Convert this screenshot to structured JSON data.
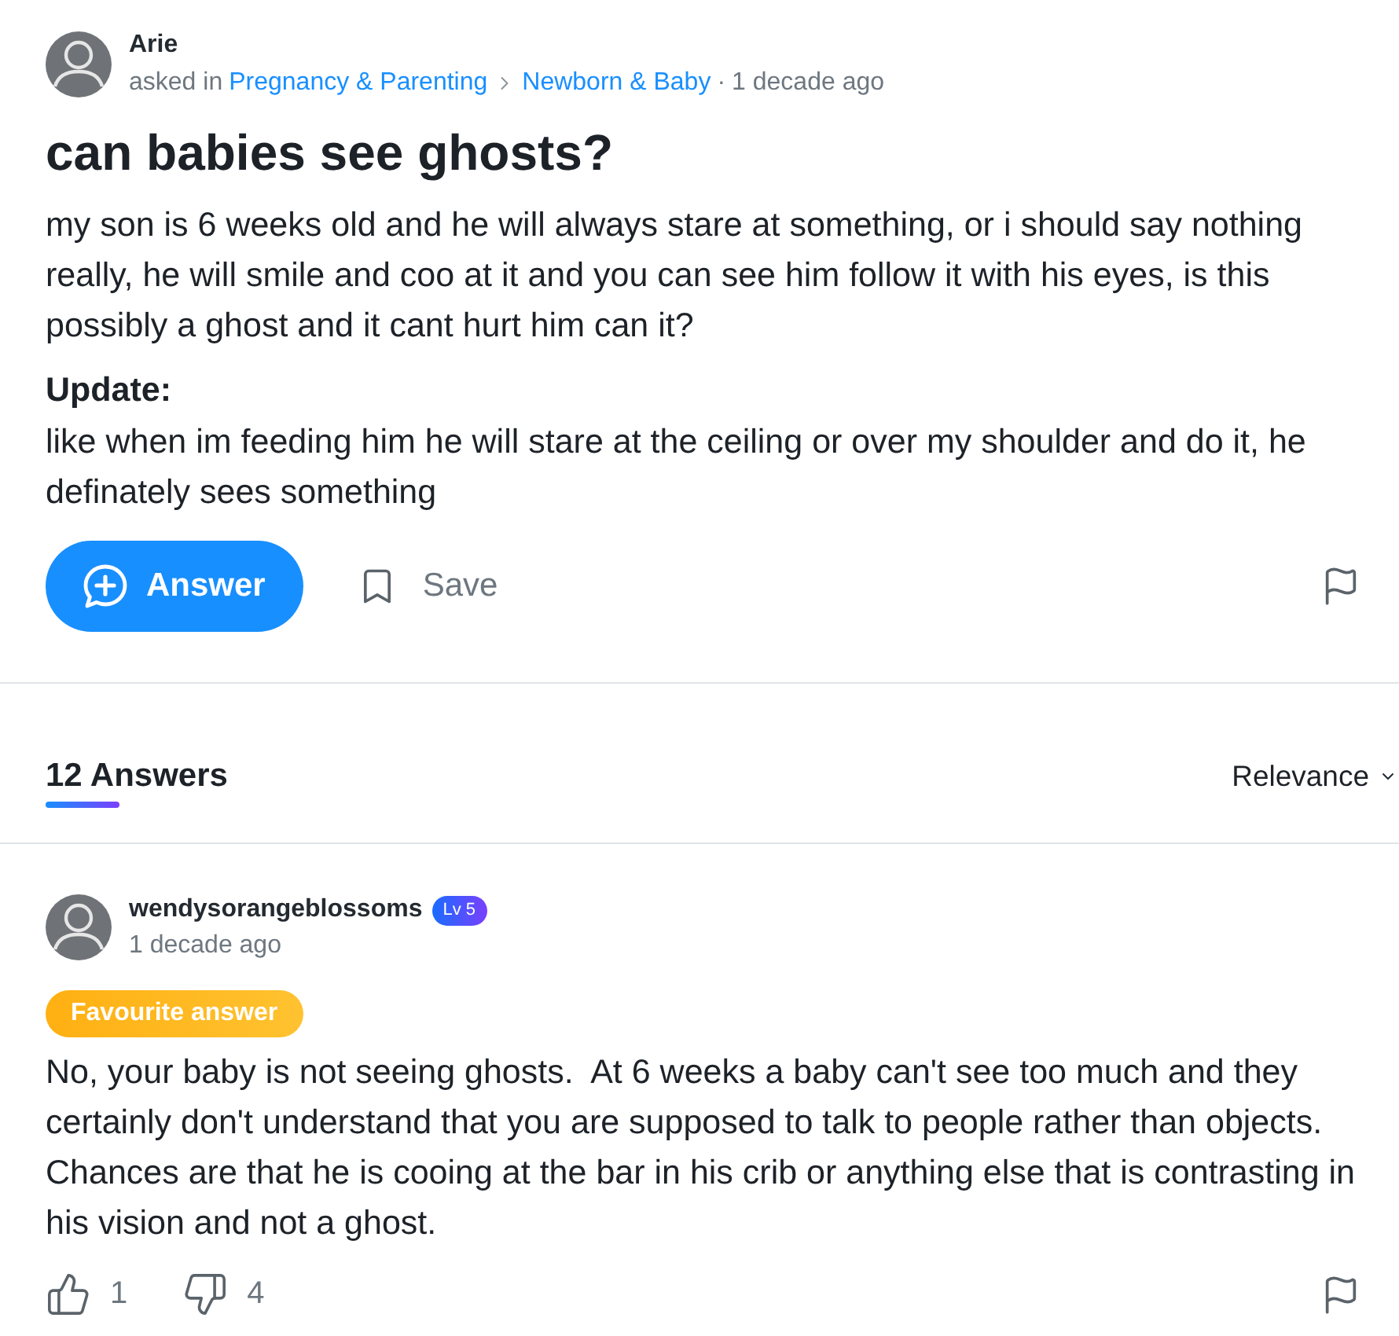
{
  "question": {
    "author": "Arie",
    "asked_in": "asked in",
    "breadcrumb": [
      "Pregnancy & Parenting",
      "Newborn & Baby"
    ],
    "separator": "·",
    "time": "1 decade ago",
    "title": "can babies see ghosts?",
    "body": "my son is 6 weeks old and he will always stare at something, or i should say nothing really, he will smile and coo at it and you can see him follow it with his eyes, is this possibly a ghost and it cant hurt him can it?",
    "update_label": "Update:",
    "update": "like when im feeding him he will stare at the ceiling or over my shoulder and do it, he definately sees something"
  },
  "actions": {
    "answer_button": "Answer",
    "save_button": "Save"
  },
  "answers_header": {
    "count": "12 Answers",
    "sort": "Relevance"
  },
  "answers": [
    {
      "author": "wendysorangeblossoms",
      "level_badge": "Lv 5",
      "time": "1 decade ago",
      "badge": "Favourite answer",
      "text": "No, your baby is not seeing ghosts.  At 6 weeks a baby can't see too much and they certainly don't understand that you are supposed to talk to people rather than objects. Chances are that he is cooing at the bar in his crib or anything else that is contrasting in his vision and not a ghost.",
      "likes": "1",
      "dislikes": "4"
    }
  ]
}
